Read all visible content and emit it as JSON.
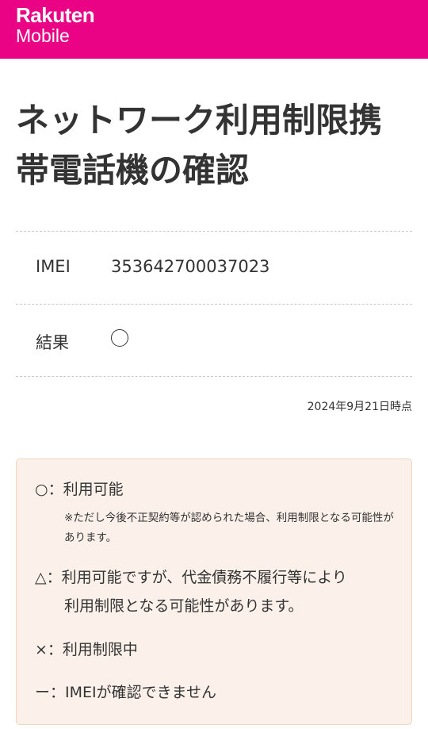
{
  "header": {
    "brand_top": "Rakuten",
    "brand_bottom": "Mobile",
    "bg_color": "#ea0485"
  },
  "page": {
    "title_line1": "ネットワーク利用制限携",
    "title_line2": "帯電話機の確認"
  },
  "result": {
    "imei_label": "IMEI",
    "imei_value": "353642700037023",
    "result_label": "結果",
    "result_value": "○",
    "timestamp": "2024年9月21日時点"
  },
  "legend": {
    "item1": "○：利用可能",
    "item1_note": "※ただし今後不正契約等が認められた場合、利用制限となる可能性があります。",
    "item2_line1": "△：利用可能ですが、代金債務不履行等により",
    "item2_line2": "利用制限となる可能性があります。",
    "item3": "×：利用制限中",
    "item4": "ー：IMEIが確認できません",
    "bg_color": "#fcf1ea"
  }
}
